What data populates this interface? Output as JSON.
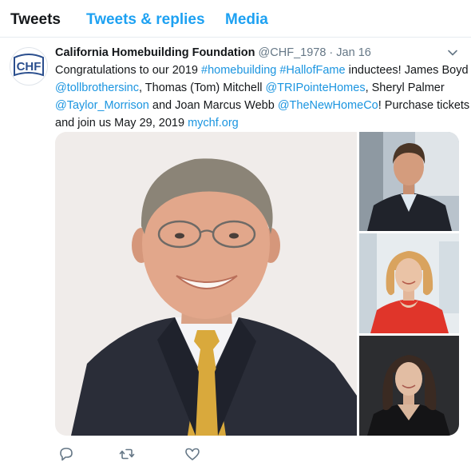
{
  "tabs": [
    {
      "label": "Tweets"
    },
    {
      "label": "Tweets & replies"
    },
    {
      "label": "Media"
    }
  ],
  "tweet": {
    "avatar_text": "CHF",
    "name": "California Homebuilding Foundation",
    "handle": "@CHF_1978",
    "separator": "·",
    "date": "Jan 16",
    "text": {
      "l1_a": "Congratulations to our 2019 ",
      "l1_tag1": "#homebuilding",
      "l1_sp": " ",
      "l1_tag2": "#HallofFame",
      "l1_b": " inductees! James Boyd",
      "l2_m1": "@tollbrothersinc",
      "l2_a": ", Thomas (Tom) Mitchell ",
      "l2_m2": "@TRIPointeHomes",
      "l2_b": ", Sheryl Palmer",
      "l3_m1": "@Taylor_Morrison",
      "l3_a": " and Joan Marcus Webb ",
      "l3_m2": "@TheNewHomeCo",
      "l3_b": "! Purchase tickets",
      "l4_a": "and join us May 29, 2019 ",
      "l4_link": "mychf.org"
    }
  },
  "icons": {
    "caret": "chevron-down-icon",
    "reply": "reply-icon",
    "retweet": "retweet-icon",
    "like": "heart-icon"
  },
  "colors": {
    "accent": "#1da1f2",
    "link": "#1b95e0",
    "secondary_text": "#657786",
    "logo_blue": "#2b4f8e"
  }
}
